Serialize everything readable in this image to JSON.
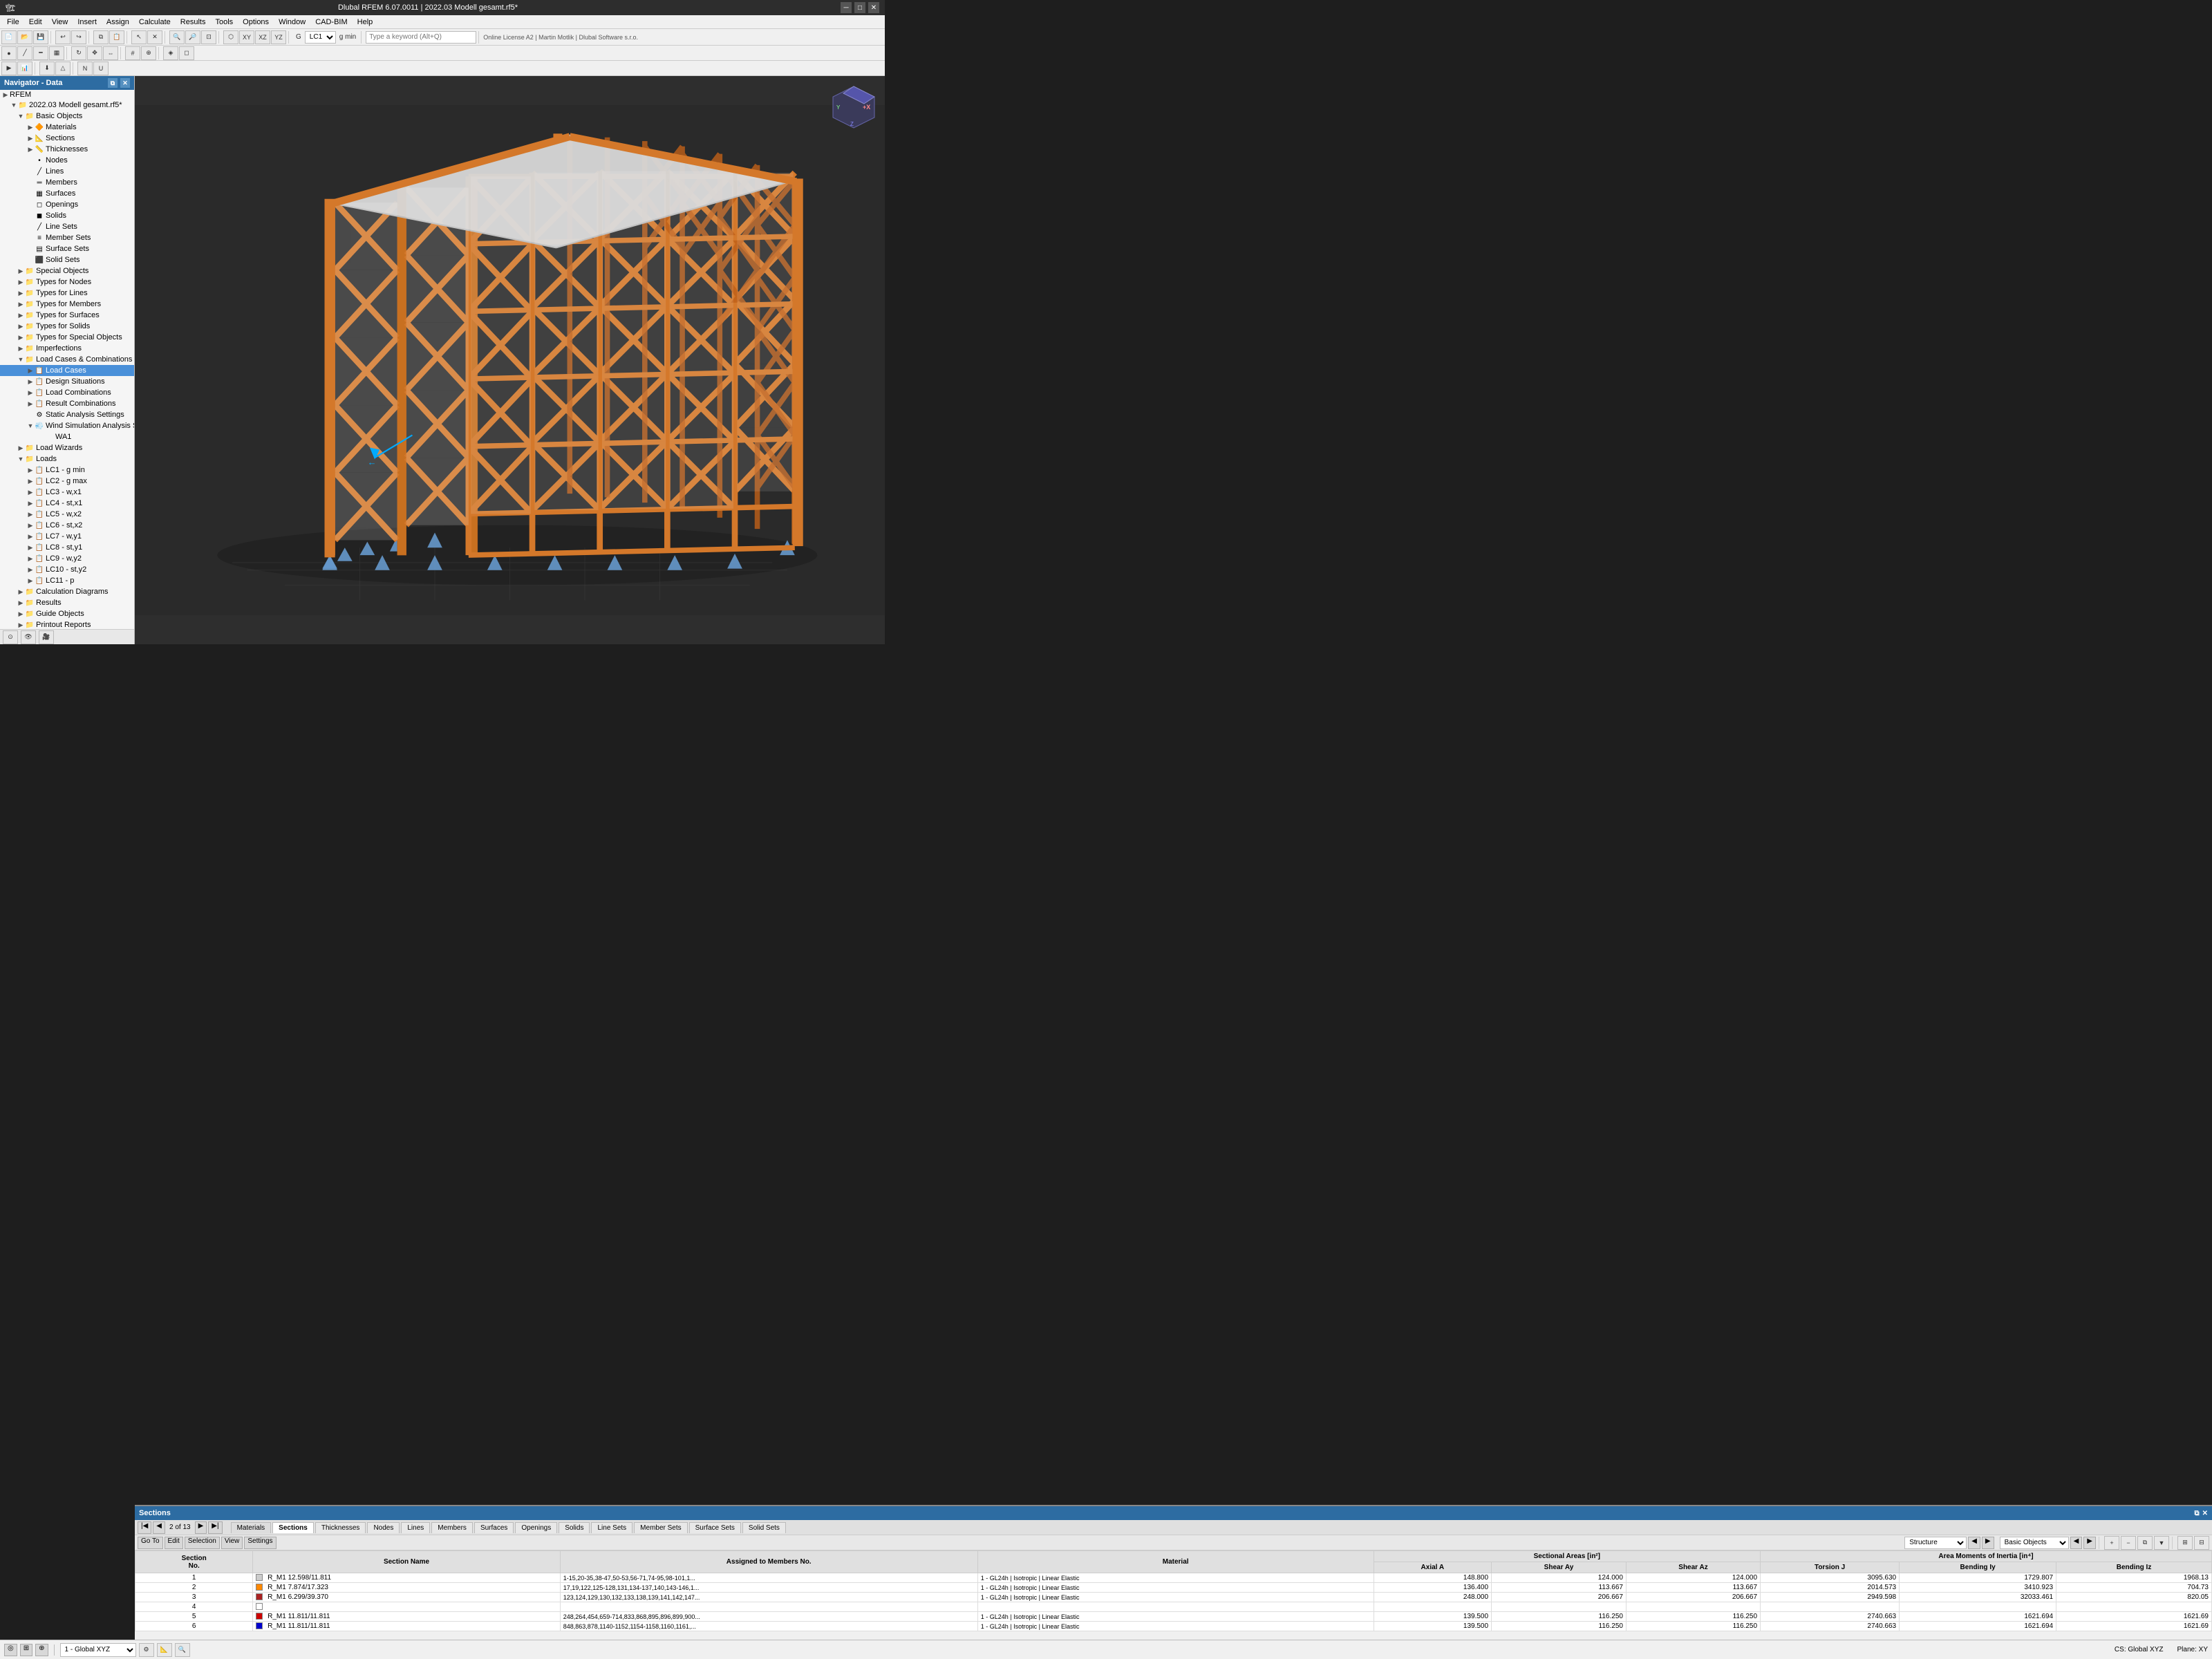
{
  "titleBar": {
    "title": "Dlubal RFEM 6.07.0011 | 2022.03 Modell gesamt.rf5*",
    "minimize": "─",
    "maximize": "□",
    "close": "✕"
  },
  "menuBar": {
    "items": [
      "File",
      "Edit",
      "View",
      "Insert",
      "Assign",
      "Calculate",
      "Results",
      "Tools",
      "Options",
      "Window",
      "CAD-BIM",
      "Help"
    ]
  },
  "toolbar": {
    "lcLabel": "LC1",
    "gminLabel": "g min",
    "searchPlaceholder": "Type a keyword (Alt+Q)",
    "licenseInfo": "Online License A2 | Martin Motlik | Dlubal Software s.r.o."
  },
  "navigator": {
    "title": "Navigator - Data",
    "rfem": "RFEM",
    "model": "2022.03 Modell gesamt.rf5*",
    "tree": [
      {
        "id": "basic-objects",
        "label": "Basic Objects",
        "level": 0,
        "expanded": true,
        "icon": "📁"
      },
      {
        "id": "materials",
        "label": "Materials",
        "level": 1,
        "icon": "🔶"
      },
      {
        "id": "sections",
        "label": "Sections",
        "level": 1,
        "icon": "📐"
      },
      {
        "id": "thicknesses",
        "label": "Thicknesses",
        "level": 1,
        "icon": "📏"
      },
      {
        "id": "nodes",
        "label": "Nodes",
        "level": 1,
        "icon": "•"
      },
      {
        "id": "lines",
        "label": "Lines",
        "level": 1,
        "icon": "/"
      },
      {
        "id": "members",
        "label": "Members",
        "level": 1,
        "icon": "═"
      },
      {
        "id": "surfaces",
        "label": "Surfaces",
        "level": 1,
        "icon": "▦"
      },
      {
        "id": "openings",
        "label": "Openings",
        "level": 1,
        "icon": "◻"
      },
      {
        "id": "solids",
        "label": "Solids",
        "level": 1,
        "icon": "◼"
      },
      {
        "id": "line-sets",
        "label": "Line Sets",
        "level": 1,
        "icon": "/"
      },
      {
        "id": "member-sets",
        "label": "Member Sets",
        "level": 1,
        "icon": "≡"
      },
      {
        "id": "surface-sets",
        "label": "Surface Sets",
        "level": 1,
        "icon": "▤"
      },
      {
        "id": "solid-sets",
        "label": "Solid Sets",
        "level": 1,
        "icon": "⬛"
      },
      {
        "id": "special-objects",
        "label": "Special Objects",
        "level": 0,
        "expanded": false,
        "icon": "📁"
      },
      {
        "id": "types-for-nodes",
        "label": "Types for Nodes",
        "level": 0,
        "expanded": false,
        "icon": "📁"
      },
      {
        "id": "types-for-lines",
        "label": "Types for Lines",
        "level": 0,
        "expanded": false,
        "icon": "📁"
      },
      {
        "id": "types-for-members",
        "label": "Types for Members",
        "level": 0,
        "expanded": false,
        "icon": "📁"
      },
      {
        "id": "types-for-surfaces",
        "label": "Types for Surfaces",
        "level": 0,
        "expanded": false,
        "icon": "📁"
      },
      {
        "id": "types-for-solids",
        "label": "Types for Solids",
        "level": 0,
        "expanded": false,
        "icon": "📁"
      },
      {
        "id": "types-for-special-objects",
        "label": "Types for Special Objects",
        "level": 0,
        "expanded": false,
        "icon": "📁"
      },
      {
        "id": "imperfections",
        "label": "Imperfections",
        "level": 0,
        "expanded": false,
        "icon": "📁"
      },
      {
        "id": "load-cases-combinations",
        "label": "Load Cases & Combinations",
        "level": 0,
        "expanded": true,
        "icon": "📁"
      },
      {
        "id": "load-cases",
        "label": "Load Cases",
        "level": 1,
        "icon": "📋",
        "selected": true
      },
      {
        "id": "design-situations",
        "label": "Design Situations",
        "level": 1,
        "icon": "📋"
      },
      {
        "id": "load-combinations",
        "label": "Load Combinations",
        "level": 1,
        "icon": "📋"
      },
      {
        "id": "result-combinations",
        "label": "Result Combinations",
        "level": 1,
        "icon": "📋"
      },
      {
        "id": "static-analysis-settings",
        "label": "Static Analysis Settings",
        "level": 1,
        "icon": "⚙"
      },
      {
        "id": "wind-simulation-settings",
        "label": "Wind Simulation Analysis Settings",
        "level": 1,
        "icon": "💨"
      },
      {
        "id": "wa1",
        "label": "WA1",
        "level": 2,
        "icon": ""
      },
      {
        "id": "load-wizards",
        "label": "Load Wizards",
        "level": 0,
        "expanded": false,
        "icon": "📁"
      },
      {
        "id": "loads",
        "label": "Loads",
        "level": 0,
        "expanded": true,
        "icon": "📁"
      },
      {
        "id": "lc1",
        "label": "LC1 - g min",
        "level": 1,
        "icon": "📋"
      },
      {
        "id": "lc2",
        "label": "LC2 - g max",
        "level": 1,
        "icon": "📋"
      },
      {
        "id": "lc3",
        "label": "LC3 - w,x1",
        "level": 1,
        "icon": "📋"
      },
      {
        "id": "lc4",
        "label": "LC4 - st,x1",
        "level": 1,
        "icon": "📋"
      },
      {
        "id": "lc5",
        "label": "LC5 - w,x2",
        "level": 1,
        "icon": "📋"
      },
      {
        "id": "lc6",
        "label": "LC6 - st,x2",
        "level": 1,
        "icon": "📋"
      },
      {
        "id": "lc7",
        "label": "LC7 - w,y1",
        "level": 1,
        "icon": "📋"
      },
      {
        "id": "lc8",
        "label": "LC8 - st,y1",
        "level": 1,
        "icon": "📋"
      },
      {
        "id": "lc9",
        "label": "LC9 - w,y2",
        "level": 1,
        "icon": "📋"
      },
      {
        "id": "lc10",
        "label": "LC10 - st,y2",
        "level": 1,
        "icon": "📋"
      },
      {
        "id": "lc11",
        "label": "LC11 - p",
        "level": 1,
        "icon": "📋"
      },
      {
        "id": "calculation-diagrams",
        "label": "Calculation Diagrams",
        "level": 0,
        "expanded": false,
        "icon": "📁"
      },
      {
        "id": "results",
        "label": "Results",
        "level": 0,
        "expanded": false,
        "icon": "📁"
      },
      {
        "id": "guide-objects",
        "label": "Guide Objects",
        "level": 0,
        "expanded": false,
        "icon": "📁"
      },
      {
        "id": "printout-reports",
        "label": "Printout Reports",
        "level": 0,
        "expanded": false,
        "icon": "📁"
      }
    ]
  },
  "sections": {
    "panelTitle": "Sections",
    "toolbar": {
      "dropdown1": "Structure",
      "dropdown2": "Basic Objects"
    },
    "menu": [
      "Go To",
      "Edit",
      "Selection",
      "View",
      "Settings"
    ],
    "columns": {
      "sectionNo": "Section No.",
      "sectionName": "Section Name",
      "assignedToMembersNo": "Assigned to Members No.",
      "material": "Material",
      "axialA": "Axial A",
      "shearAy": "Shear Ay",
      "shearAz": "Shear Az",
      "torsionJ": "Torsion J",
      "bendingIy": "Bending Iy",
      "bendingIz": "Bending Iz"
    },
    "sectionHeaders": {
      "sectionalAreas": "Sectional Areas [in²]",
      "areaMomentsOfInertia": "Area Moments of Inertia [in⁴]"
    },
    "rows": [
      {
        "no": 1,
        "color": "#cccccc",
        "name": "R_M1 12.598/11.811",
        "assigned": "1-15,20-35,38-47,50-53,56-71,74-95,98-101,1...",
        "material": "1 - GL24h | Isotropic | Linear Elastic",
        "axialA": "148.800",
        "shearAy": "124.000",
        "shearAz": "124.000",
        "torsionJ": "3095.630",
        "bendingIy": "1729.807",
        "bendingIz": "1968.13"
      },
      {
        "no": 2,
        "color": "#ff8800",
        "name": "R_M1 7.874/17.323",
        "assigned": "17,19,122,125-128,131,134-137,140,143-146,1...",
        "material": "1 - GL24h | Isotropic | Linear Elastic",
        "axialA": "136.400",
        "shearAy": "113.667",
        "shearAz": "113.667",
        "torsionJ": "2014.573",
        "bendingIy": "3410.923",
        "bendingIz": "704.73"
      },
      {
        "no": 3,
        "color": "#aa2222",
        "name": "R_M1 6.299/39.370",
        "assigned": "123,124,129,130,132,133,138,139,141,142,147...",
        "material": "1 - GL24h | Isotropic | Linear Elastic",
        "axialA": "248.000",
        "shearAy": "206.667",
        "shearAz": "206.667",
        "torsionJ": "2949.598",
        "bendingIy": "32033.461",
        "bendingIz": "820.05"
      },
      {
        "no": 4,
        "color": "#ffffff",
        "name": "",
        "assigned": "",
        "material": "",
        "axialA": "",
        "shearAy": "",
        "shearAz": "",
        "torsionJ": "",
        "bendingIy": "",
        "bendingIz": ""
      },
      {
        "no": 5,
        "color": "#cc0000",
        "name": "R_M1 11.811/11.811",
        "assigned": "248,264,454,659-714,833,868,895,896,899,900...",
        "material": "1 - GL24h | Isotropic | Linear Elastic",
        "axialA": "139.500",
        "shearAy": "116.250",
        "shearAz": "116.250",
        "torsionJ": "2740.663",
        "bendingIy": "1621.694",
        "bendingIz": "1621.69"
      },
      {
        "no": 6,
        "color": "#0000cc",
        "name": "R_M1 11.811/11.811",
        "assigned": "848,863,878,1140-1152,1154-1158,1160,1161,...",
        "material": "1 - GL24h | Isotropic | Linear Elastic",
        "axialA": "139.500",
        "shearAy": "116.250",
        "shearAz": "116.250",
        "torsionJ": "2740.663",
        "bendingIy": "1621.694",
        "bendingIz": "1621.69"
      }
    ]
  },
  "bottomTabs": [
    "Materials",
    "Sections",
    "Thicknesses",
    "Nodes",
    "Lines",
    "Members",
    "Surfaces",
    "Openings",
    "Solids",
    "Line Sets",
    "Member Sets",
    "Surface Sets",
    "Solid Sets"
  ],
  "navInfo": {
    "pageInfo": "2 of 13"
  },
  "statusBar": {
    "csLabel": "1 - Global XYZ",
    "csRight": "CS: Global XYZ",
    "planeRight": "Plane: XY"
  }
}
